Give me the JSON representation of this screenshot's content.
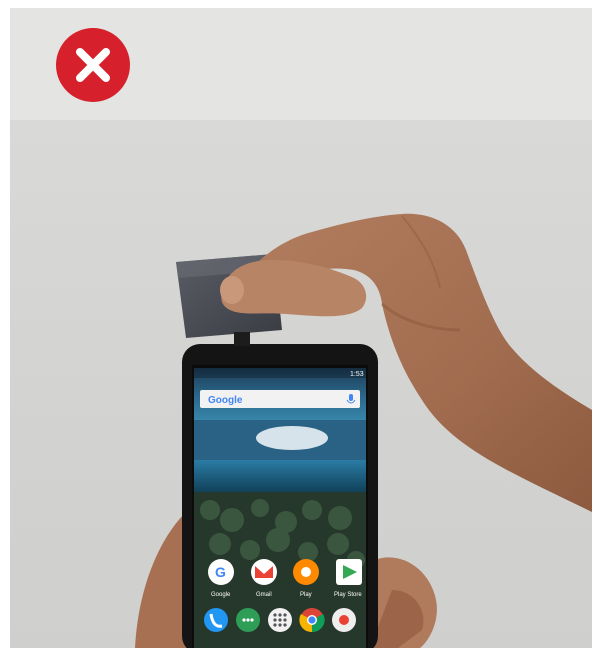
{
  "badge": {
    "icon": "close-icon",
    "color": "#d6202b"
  },
  "phone": {
    "status_time": "1:53",
    "search_logo": "Google",
    "apps_row": [
      {
        "label": "Google",
        "icon": "google-app-icon"
      },
      {
        "label": "Gmail",
        "icon": "gmail-icon"
      },
      {
        "label": "Play",
        "icon": "play-music-icon"
      },
      {
        "label": "Play Store",
        "icon": "play-store-icon"
      }
    ],
    "dock": [
      {
        "icon": "phone-icon"
      },
      {
        "icon": "messenger-icon"
      },
      {
        "icon": "app-drawer-icon"
      },
      {
        "icon": "chrome-icon"
      },
      {
        "icon": "camera-icon"
      }
    ]
  },
  "card_reader": {
    "icon": "card-reader-icon"
  }
}
